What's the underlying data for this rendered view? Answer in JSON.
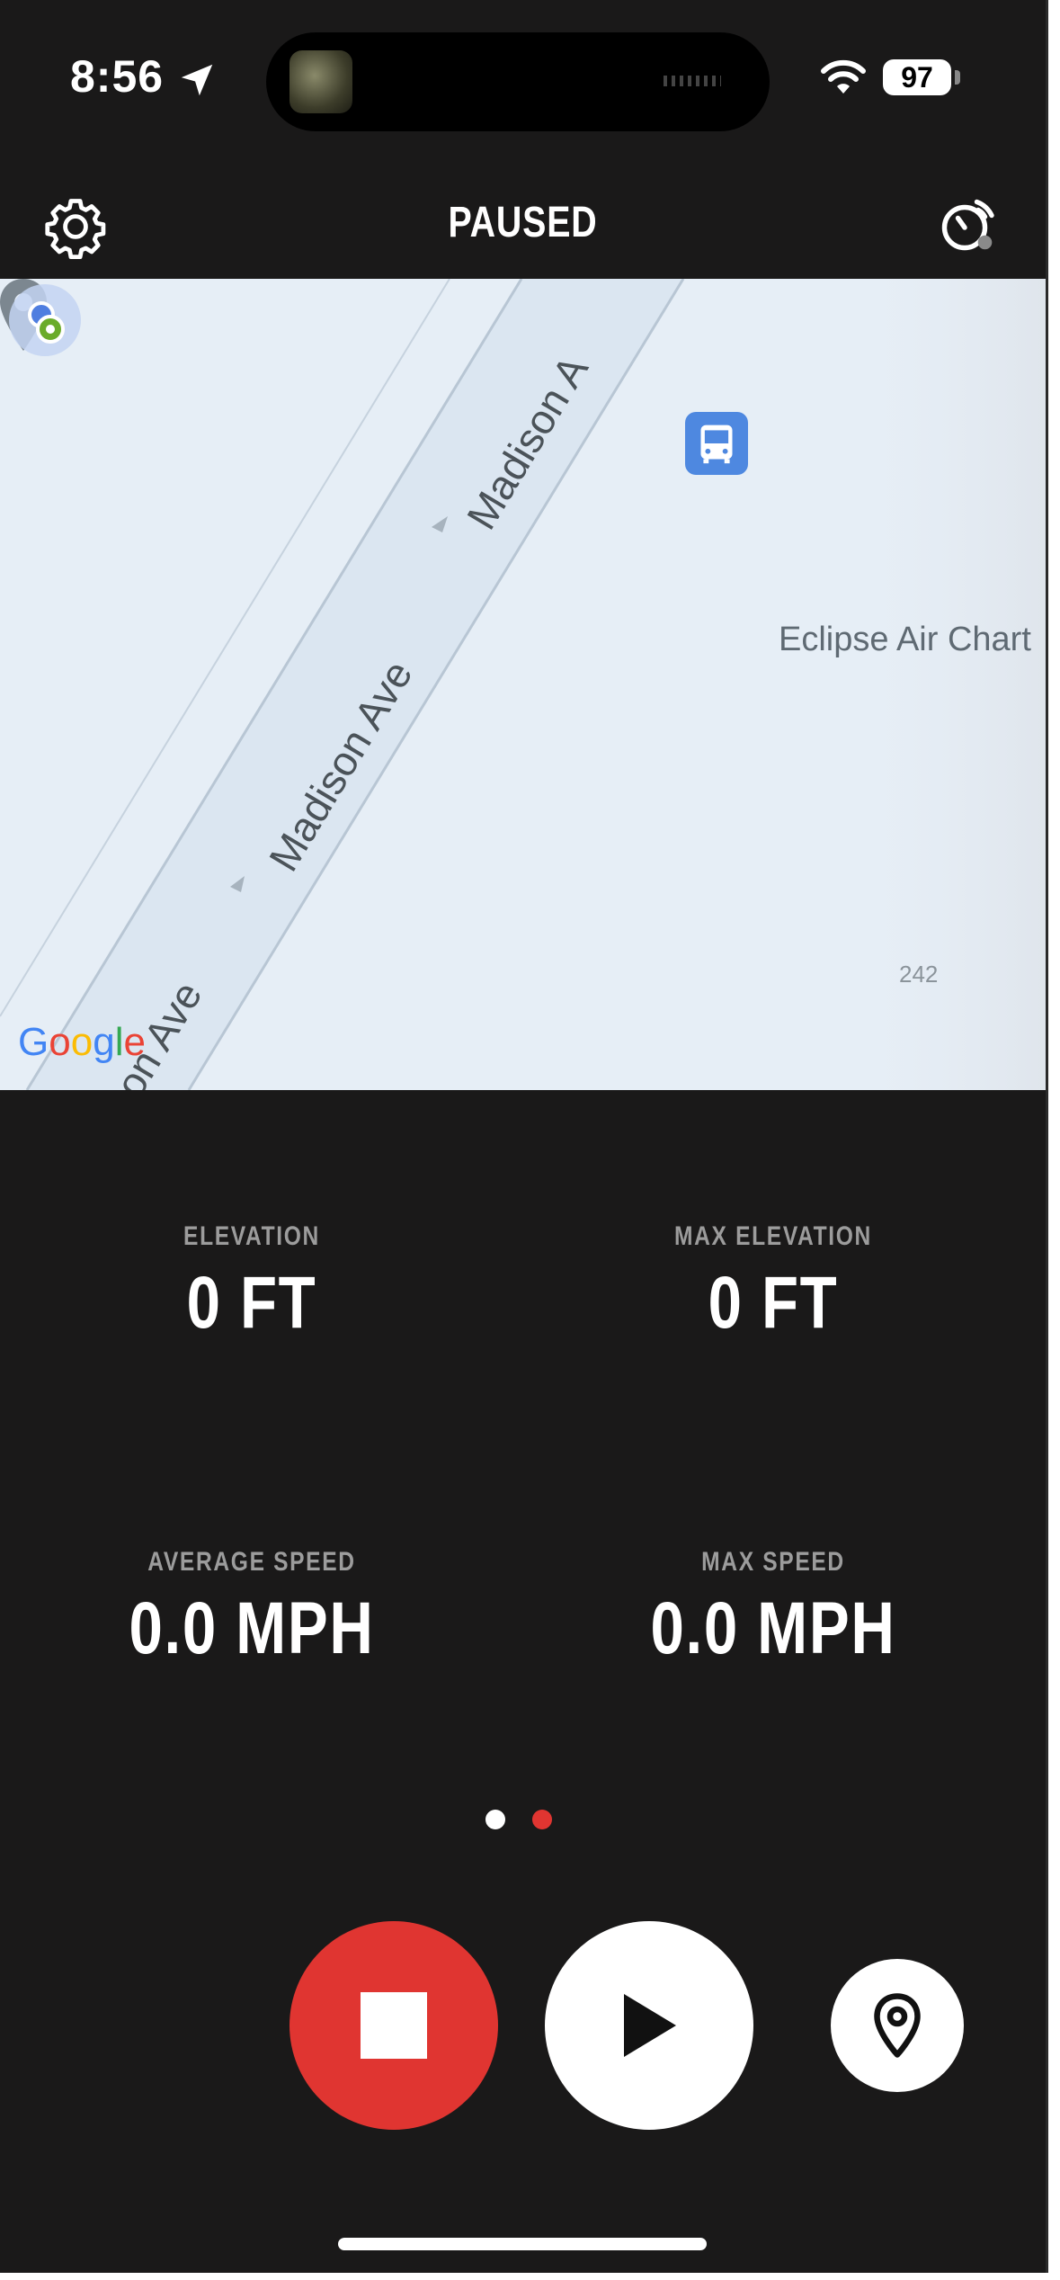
{
  "status_bar": {
    "time": "8:56",
    "battery": "97"
  },
  "header": {
    "title": "PAUSED"
  },
  "map": {
    "streets": [
      "Madison A",
      "Madison Ave",
      "Madison Ave",
      "ison Ave"
    ],
    "place_label": "Eclipse Air Chart",
    "road_number": "242",
    "attribution": "Google"
  },
  "stats": {
    "elevation": {
      "label": "ELEVATION",
      "value": "0 FT"
    },
    "max_elevation": {
      "label": "MAX ELEVATION",
      "value": "0 FT"
    },
    "average_speed": {
      "label": "AVERAGE SPEED",
      "value": "0.0 MPH"
    },
    "max_speed": {
      "label": "MAX SPEED",
      "value": "0.0 MPH"
    }
  },
  "page_indicator": {
    "pages": 2,
    "active_page": 2,
    "inactive_color": "#ffffff",
    "active_color": "#e03531"
  },
  "controls": {
    "stop_icon": "stop-icon",
    "play_icon": "play-icon",
    "location_icon": "location-pin-icon",
    "stop_color": "#e03531"
  }
}
